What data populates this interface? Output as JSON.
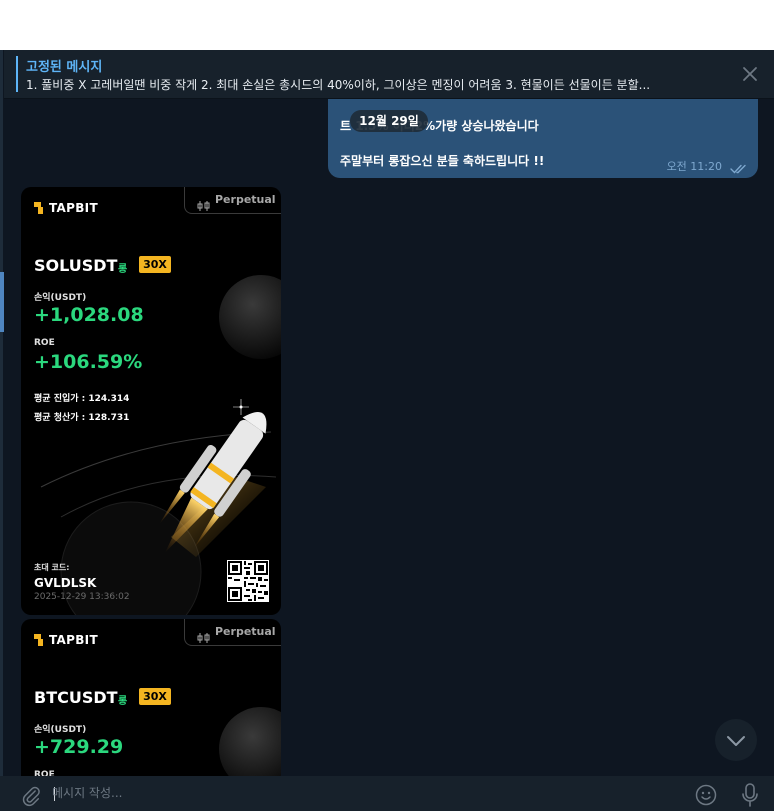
{
  "pinned": {
    "title": "고정된 메시지",
    "text": "1. 풀비중 X 고레버일땐 비중 작게 2. 최대 손실은 총시드의 40%이하, 그이상은 멘징이 어려움 3. 현물이든 선물이든 분할..."
  },
  "message": {
    "line1": "트 1.5% 이더2%가량 상승나왔습니다",
    "line2": "주말부터 롱잡으신 분들 축하드립니다 !!",
    "time": "오전 11:20"
  },
  "date_pill": "12월 29일",
  "cards": [
    {
      "brand": "TAPBIT",
      "tag": "Perpetual",
      "symbol": "SOLUSDT",
      "side": "롱",
      "leverage": "30X",
      "pnl_label": "손익(USDT)",
      "pnl": "+1,028.08",
      "roe_label": "ROE",
      "roe": "+106.59%",
      "entry": "평균 진입가 : 124.314",
      "exit": "평균 청산가 : 128.731",
      "invite_label": "초대 코드:",
      "invite_code": "GVLDLSK",
      "timestamp": "2025-12-29 13:36:02"
    },
    {
      "brand": "TAPBIT",
      "tag": "Perpetual",
      "symbol": "BTCUSDT",
      "side": "롱",
      "leverage": "30X",
      "pnl_label": "손익(USDT)",
      "pnl": "+729.29",
      "roe_label": "ROE"
    }
  ],
  "input": {
    "placeholder": "메시지 작성..."
  },
  "colors": {
    "accent": "#5eb5f7",
    "bubble": "#2b5278",
    "profit": "#2bd87e",
    "brand": "#f4b521"
  }
}
